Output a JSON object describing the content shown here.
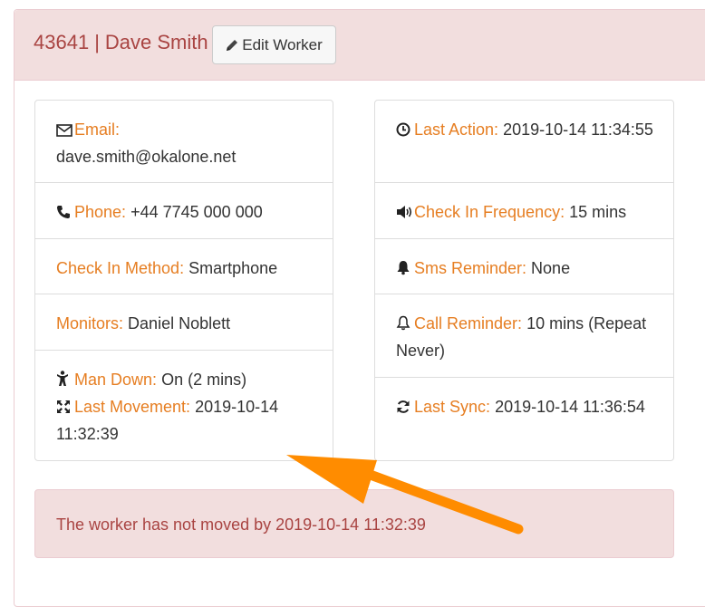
{
  "header": {
    "worker_id": "43641",
    "separator": "|",
    "worker_name": "Dave Smith",
    "edit_label": "Edit Worker"
  },
  "left": {
    "email_label": "Email:",
    "email_value": "dave.smith@okalone.net",
    "phone_label": "Phone:",
    "phone_value": "+44 7745 000 000",
    "method_label": "Check In Method:",
    "method_value": "Smartphone",
    "monitors_label": "Monitors:",
    "monitors_value": "Daniel Noblett",
    "mandown_label": "Man Down:",
    "mandown_value": "On (2 mins)",
    "movement_label": "Last Movement:",
    "movement_value": "2019-10-14 11:32:39"
  },
  "right": {
    "action_label": "Last Action:",
    "action_value": "2019-10-14 11:34:55",
    "frequency_label": "Check In Frequency:",
    "frequency_value": "15 mins",
    "sms_label": "Sms Reminder:",
    "sms_value": "None",
    "call_label": "Call Reminder:",
    "call_value": "10 mins (Repeat Never)",
    "sync_label": "Last Sync:",
    "sync_value": "2019-10-14 11:36:54"
  },
  "alert": {
    "text": "The worker has not moved by 2019-10-14 11:32:39"
  },
  "icons": {
    "edit": "pencil-icon",
    "email": "envelope-icon",
    "phone": "phone-icon",
    "mandown": "person-icon",
    "movement": "arrows-expand-icon",
    "action": "clock-icon",
    "frequency": "volume-icon",
    "sms": "bell-icon",
    "call": "bell-outline-icon",
    "sync": "refresh-icon"
  },
  "colors": {
    "heading_bg": "#f2dede",
    "heading_text": "#a94442",
    "label": "#e67e22",
    "arrow": "#ff8c00"
  }
}
